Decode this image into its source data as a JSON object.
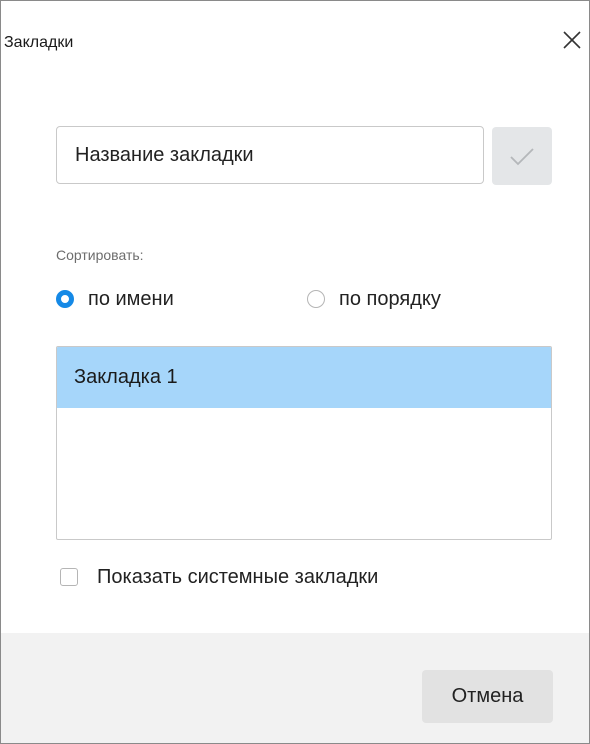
{
  "dialog": {
    "title": "Закладки",
    "close_icon": "close-icon"
  },
  "name_field": {
    "placeholder": "Название закладки",
    "value": "",
    "confirm_icon": "checkmark-icon"
  },
  "sort": {
    "label": "Сортировать:",
    "options": [
      {
        "label": "по имени",
        "selected": true
      },
      {
        "label": "по порядку",
        "selected": false
      }
    ]
  },
  "bookmarks": {
    "items": [
      {
        "label": "Закладка 1",
        "selected": true
      }
    ]
  },
  "show_system": {
    "label": "Показать системные закладки",
    "checked": false
  },
  "footer": {
    "cancel_label": "Отмена"
  },
  "colors": {
    "accent": "#1589e6",
    "selection": "#a6d6fa",
    "footer_bg": "#f2f2f2"
  }
}
